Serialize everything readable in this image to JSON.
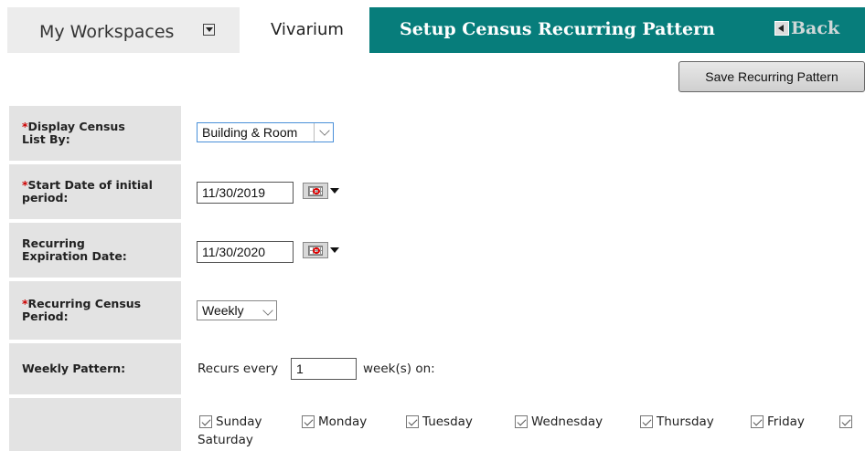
{
  "topbar": {
    "workspaces_label": "My Workspaces",
    "active_tab": "Vivarium",
    "page_title": "Setup Census Recurring Pattern",
    "back_label": "Back",
    "accent_color": "#077d7b"
  },
  "toolbar": {
    "save_label": "Save Recurring Pattern"
  },
  "form": {
    "required_marker": "*",
    "display_by": {
      "label_line1": "Display Census",
      "label_line2": "List By:",
      "value": "Building & Room"
    },
    "start_date": {
      "label_line1": "Start Date of initial",
      "label_line2": "period:",
      "value": "11/30/2019"
    },
    "expiration": {
      "label_line1": "Recurring",
      "label_line2": "Expiration Date:",
      "value": "11/30/2020"
    },
    "period": {
      "label_line1": "Recurring Census",
      "label_line2": "Period:",
      "value": "Weekly"
    },
    "weekly": {
      "label": "Weekly Pattern:",
      "prefix": "Recurs every",
      "value": "1",
      "suffix": "week(s) on:"
    },
    "days": [
      {
        "label": "Sunday",
        "checked": true
      },
      {
        "label": "Monday",
        "checked": true
      },
      {
        "label": "Tuesday",
        "checked": true
      },
      {
        "label": "Wednesday",
        "checked": true
      },
      {
        "label": "Thursday",
        "checked": true
      },
      {
        "label": "Friday",
        "checked": true
      },
      {
        "label": "Saturday",
        "checked": true
      }
    ]
  }
}
